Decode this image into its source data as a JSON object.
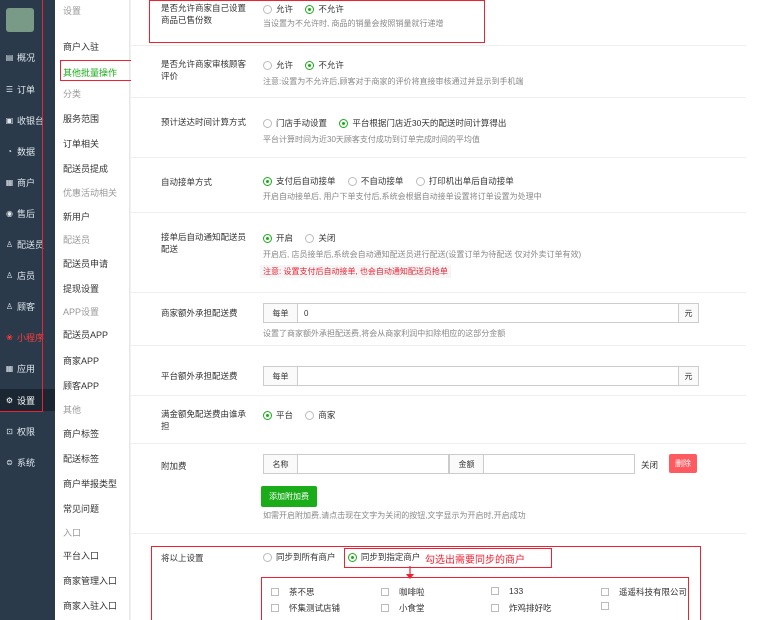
{
  "nav": {
    "items": [
      {
        "icon": "chart-icon",
        "glyph": "▤",
        "label": "概况"
      },
      {
        "icon": "order-icon",
        "glyph": "☰",
        "label": "订单"
      },
      {
        "icon": "cashier-icon",
        "glyph": "▣",
        "label": "收银台"
      },
      {
        "icon": "data-icon",
        "glyph": "◔",
        "label": "数据"
      },
      {
        "icon": "shop-icon",
        "glyph": "▦",
        "label": "商户"
      },
      {
        "icon": "aftersale-icon",
        "glyph": "◉",
        "label": "售后"
      },
      {
        "icon": "courier-icon",
        "glyph": "♙",
        "label": "配送员"
      },
      {
        "icon": "clerk-icon",
        "glyph": "♙",
        "label": "店员"
      },
      {
        "icon": "customer-icon",
        "glyph": "♙",
        "label": "顾客"
      },
      {
        "icon": "miniapp-icon",
        "glyph": "❀",
        "label": "小程序"
      },
      {
        "icon": "apps-icon",
        "glyph": "▦",
        "label": "应用"
      },
      {
        "icon": "gear-icon",
        "glyph": "⚙",
        "label": "设置"
      },
      {
        "icon": "lock-icon",
        "glyph": "⊡",
        "label": "权限"
      },
      {
        "icon": "system-icon",
        "glyph": "⊜",
        "label": "系统"
      }
    ]
  },
  "sub": {
    "items": [
      {
        "label": "设置",
        "type": "grp"
      },
      {
        "label": "商户入驻",
        "type": "item"
      },
      {
        "label": "其他批量操作",
        "type": "active"
      },
      {
        "label": "分类",
        "type": "grp"
      },
      {
        "label": "服务范围",
        "type": "item"
      },
      {
        "label": "订单相关",
        "type": "item"
      },
      {
        "label": "配送员提成",
        "type": "item"
      },
      {
        "label": "优惠活动相关",
        "type": "grp"
      },
      {
        "label": "新用户",
        "type": "item"
      },
      {
        "label": "配送员",
        "type": "grp"
      },
      {
        "label": "配送员申请",
        "type": "item"
      },
      {
        "label": "提现设置",
        "type": "item"
      },
      {
        "label": "APP设置",
        "type": "grp"
      },
      {
        "label": "配送员APP",
        "type": "item"
      },
      {
        "label": "商家APP",
        "type": "item"
      },
      {
        "label": "顾客APP",
        "type": "item"
      },
      {
        "label": "其他",
        "type": "grp"
      },
      {
        "label": "商户标签",
        "type": "item"
      },
      {
        "label": "配送标签",
        "type": "item"
      },
      {
        "label": "商户举报类型",
        "type": "item"
      },
      {
        "label": "常见问题",
        "type": "item"
      },
      {
        "label": "入口",
        "type": "grp"
      },
      {
        "label": "平台入口",
        "type": "item"
      },
      {
        "label": "商家管理入口",
        "type": "item"
      },
      {
        "label": "商家入驻入口",
        "type": "item"
      }
    ]
  },
  "settings": {
    "sold_count": {
      "label": "是否允许商家自己设置商品已售份数",
      "opt1": "允许",
      "opt2": "不允许",
      "desc": "当设置为不允许时, 商品的销量会按照销量就行递增"
    },
    "review": {
      "label": "是否允许商家审核顾客评价",
      "opt1": "允许",
      "opt2": "不允许",
      "desc": "注意:设置为不允许后,顾客对于商家的评价将直接审核通过并显示到手机端"
    },
    "eta": {
      "label": "预计送达时间计算方式",
      "opt1": "门店手动设置",
      "opt2": "平台根据门店近30天的配送时间计算得出",
      "desc": "平台计算时间为近30天顾客支付成功到订单完成时间的平均值"
    },
    "auto_accept": {
      "label": "自动接单方式",
      "opt1": "支付后自动接单",
      "opt2": "不自动接单",
      "opt3": "打印机出单后自动接单",
      "desc": "开启自动接单后, 用户下单支付后,系统会根据自动接单设置将订单设置为处理中"
    },
    "notify_courier": {
      "label": "接单后自动通知配送员配送",
      "opt1": "开启",
      "opt2": "关闭",
      "desc": "开启后, 店员接单后,系统会自动通知配送员进行配送(设置订单为待配送 仅对外卖订单有效)",
      "warn": "注意: 设置支付后自动接单, 也会自动通知配送员抢单"
    },
    "merchant_fee": {
      "label": "商家额外承担配送费",
      "prefix": "每单",
      "value": "0",
      "suffix": "元",
      "desc": "设置了商家额外承担配送费,将会从商家利润中扣除相应的这部分金额"
    },
    "platform_fee": {
      "label": "平台额外承担配送费",
      "prefix": "每单",
      "value": "",
      "suffix": "元"
    },
    "free_bearer": {
      "label": "满金额免配送费由谁承担",
      "opt1": "平台",
      "opt2": "商家"
    },
    "surcharge": {
      "label": "附加费",
      "name_label": "名称",
      "amount_label": "金额",
      "close_label": "关闭",
      "delete_label": "删除",
      "add_label": "添加附加费",
      "desc": "如需开启附加费,请点击现在文字为关闭的按钮,文字显示为开启时,开启成功"
    },
    "sync": {
      "label": "将以上设置",
      "opt1": "同步到所有商户",
      "opt2": "同步到指定商户",
      "note": "勾选出需要同步的商户",
      "merchants": [
        "茶不思",
        "咖啡啦",
        "133",
        "遥遥科技有限公司",
        "怀集测试店铺",
        "小食堂",
        "炸鸡排好吃",
        ""
      ]
    }
  },
  "colors": {
    "accent": "#1aad19",
    "annotation": "#e23333",
    "nav_bg": "#2a3a4a"
  }
}
